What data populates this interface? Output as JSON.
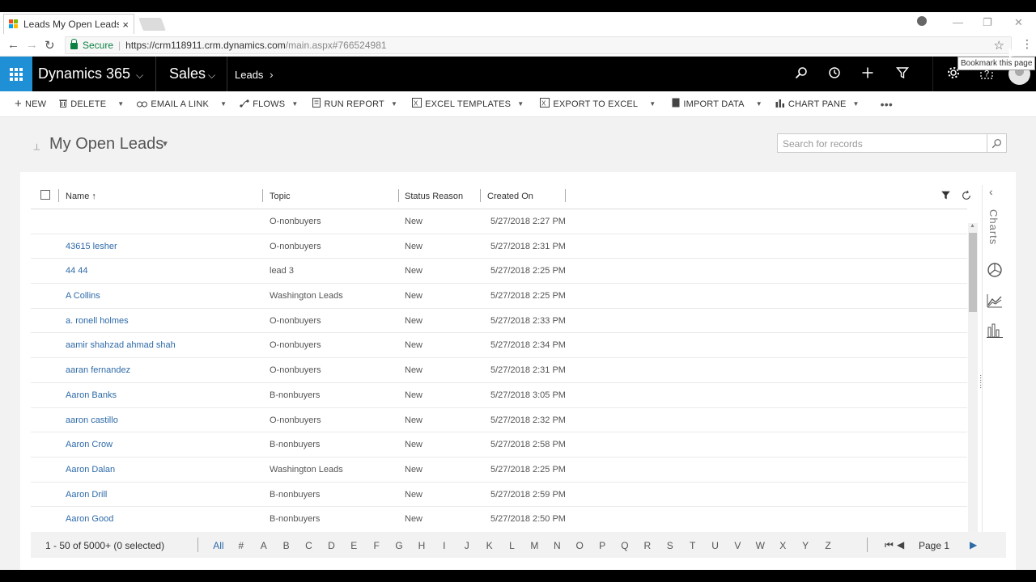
{
  "browser": {
    "tab_title": "Leads My Open Leads - M",
    "tab_close": "×",
    "secure_label": "Secure",
    "url_host": "https://crm118911.crm.dynamics.com",
    "url_path": "/main.aspx#766524981",
    "tooltip": "Bookmark this page"
  },
  "appnav": {
    "app_title": "Dynamics 365",
    "area": "Sales",
    "entity": "Leads"
  },
  "commands": [
    {
      "label": "NEW",
      "icon": "+"
    },
    {
      "label": "DELETE",
      "icon": "🗑"
    },
    {
      "label": "EMAIL A LINK",
      "icon": "⊂⊃"
    },
    {
      "label": "FLOWS",
      "icon": "⤳"
    },
    {
      "label": "RUN REPORT",
      "icon": "▤"
    },
    {
      "label": "EXCEL TEMPLATES",
      "icon": "▦"
    },
    {
      "label": "EXPORT TO EXCEL",
      "icon": "▦"
    },
    {
      "label": "IMPORT DATA",
      "icon": "▤"
    },
    {
      "label": "CHART PANE",
      "icon": "▥"
    },
    {
      "label": "•••",
      "icon": ""
    }
  ],
  "view": {
    "title": "My Open Leads",
    "search_placeholder": "Search for records"
  },
  "grid": {
    "columns": {
      "name": "Name ↑",
      "topic": "Topic",
      "status": "Status Reason",
      "created": "Created On"
    },
    "rows": [
      {
        "name": "",
        "topic": "O-nonbuyers",
        "status": "New",
        "created": "5/27/2018 2:27 PM"
      },
      {
        "name": "43615 lesher",
        "topic": "O-nonbuyers",
        "status": "New",
        "created": "5/27/2018 2:31 PM"
      },
      {
        "name": "44 44",
        "topic": "lead 3",
        "status": "New",
        "created": "5/27/2018 2:25 PM"
      },
      {
        "name": "A Collins",
        "topic": "Washington Leads",
        "status": "New",
        "created": "5/27/2018 2:25 PM"
      },
      {
        "name": "a. ronell holmes",
        "topic": "O-nonbuyers",
        "status": "New",
        "created": "5/27/2018 2:33 PM"
      },
      {
        "name": "aamir shahzad ahmad shah",
        "topic": "O-nonbuyers",
        "status": "New",
        "created": "5/27/2018 2:34 PM"
      },
      {
        "name": "aaran fernandez",
        "topic": "O-nonbuyers",
        "status": "New",
        "created": "5/27/2018 2:31 PM"
      },
      {
        "name": "Aaron Banks",
        "topic": "B-nonbuyers",
        "status": "New",
        "created": "5/27/2018 3:05 PM"
      },
      {
        "name": "aaron castillo",
        "topic": "O-nonbuyers",
        "status": "New",
        "created": "5/27/2018 2:32 PM"
      },
      {
        "name": "Aaron Crow",
        "topic": "B-nonbuyers",
        "status": "New",
        "created": "5/27/2018 2:58 PM"
      },
      {
        "name": "Aaron Dalan",
        "topic": "Washington Leads",
        "status": "New",
        "created": "5/27/2018 2:25 PM"
      },
      {
        "name": "Aaron Drill",
        "topic": "B-nonbuyers",
        "status": "New",
        "created": "5/27/2018 2:59 PM"
      },
      {
        "name": "Aaron Good",
        "topic": "B-nonbuyers",
        "status": "New",
        "created": "5/27/2018 2:50 PM"
      }
    ]
  },
  "chart_pane": {
    "label": "Charts"
  },
  "footer": {
    "record_count": "1 - 50 of 5000+ (0 selected)",
    "letters": [
      "All",
      "#",
      "A",
      "B",
      "C",
      "D",
      "E",
      "F",
      "G",
      "H",
      "I",
      "J",
      "K",
      "L",
      "M",
      "N",
      "O",
      "P",
      "Q",
      "R",
      "S",
      "T",
      "U",
      "V",
      "W",
      "X",
      "Y",
      "Z"
    ],
    "active_letter": "All",
    "page": "Page 1"
  },
  "colors": {
    "accent": "#1f8fd6",
    "link": "#2e6aa8",
    "nav_bg": "#000000"
  }
}
